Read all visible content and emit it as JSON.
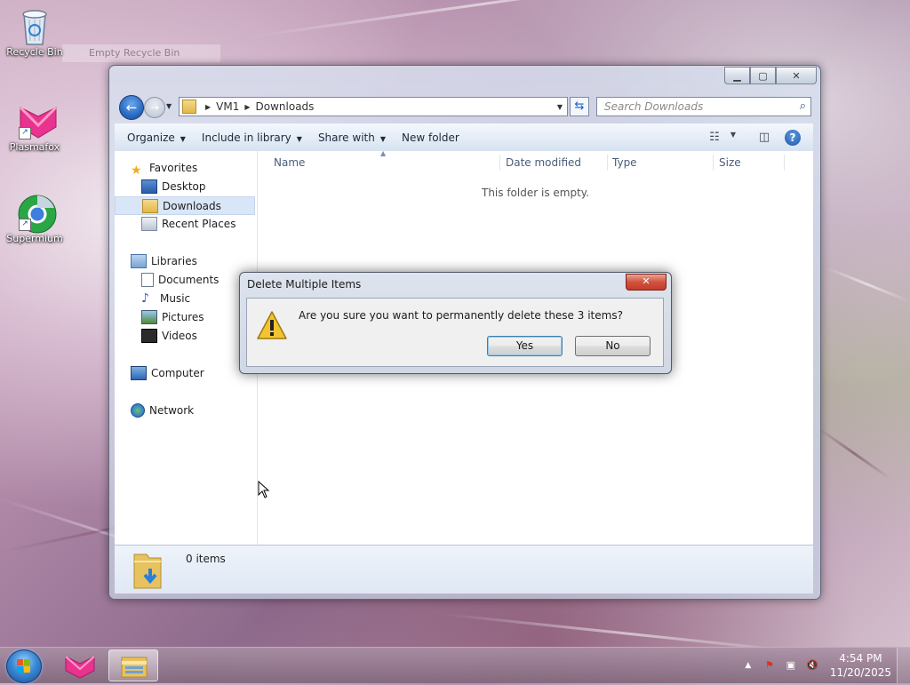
{
  "desktop": {
    "icons": [
      {
        "label": "Recycle Bin",
        "icon": "recycle-bin-icon"
      },
      {
        "label": "Plasmafox",
        "icon": "plasmafox-icon"
      },
      {
        "label": "Supermium",
        "icon": "supermium-icon"
      }
    ],
    "ghost_label": "Empty Recycle Bin"
  },
  "explorer": {
    "breadcrumb": [
      "VM1",
      "Downloads"
    ],
    "search_placeholder": "Search Downloads",
    "toolbar": {
      "organize": "Organize",
      "include_in_library": "Include in library",
      "share_with": "Share with",
      "new_folder": "New folder"
    },
    "nav": {
      "favorites": "Favorites",
      "desktop": "Desktop",
      "downloads": "Downloads",
      "recent_places": "Recent Places",
      "libraries": "Libraries",
      "documents": "Documents",
      "music": "Music",
      "pictures": "Pictures",
      "videos": "Videos",
      "computer": "Computer",
      "network": "Network"
    },
    "columns": {
      "name": "Name",
      "date_modified": "Date modified",
      "type": "Type",
      "size": "Size"
    },
    "empty_message": "This folder is empty.",
    "item_count": "0 items"
  },
  "dialog": {
    "title": "Delete Multiple Items",
    "message": "Are you sure you want to permanently delete these 3 items?",
    "yes_label": "Yes",
    "no_label": "No",
    "close_symbol": "✕"
  },
  "taskbar": {
    "time": "4:54 PM",
    "date": "11/20/2025"
  }
}
